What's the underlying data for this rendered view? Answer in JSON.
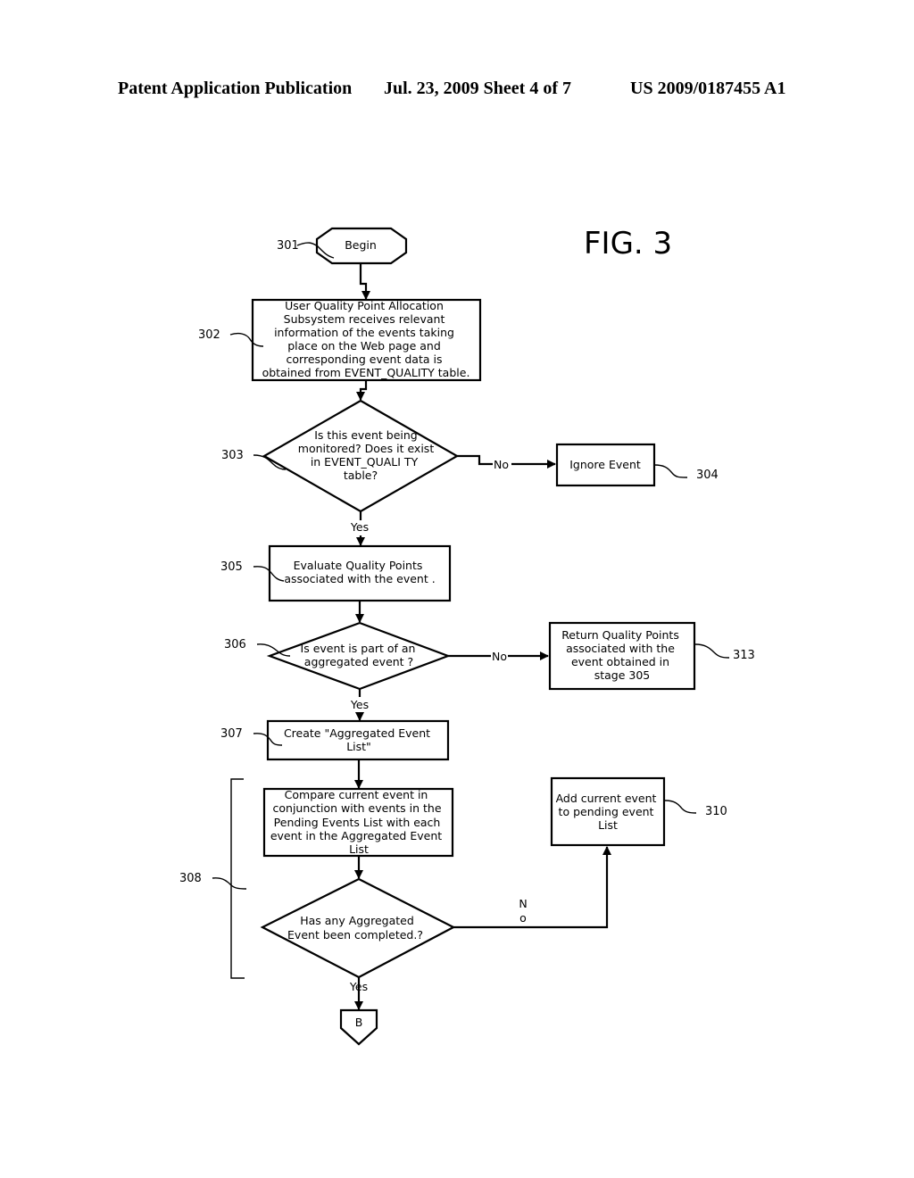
{
  "header": {
    "publication": "Patent Application Publication",
    "date_sheet": "Jul. 23, 2009   Sheet 4 of 7",
    "patent_number": "US 2009/0187455 A1"
  },
  "figure_label": "FIG. 3",
  "nodes": {
    "n301": {
      "ref": "301",
      "type": "terminator",
      "lines": [
        "Begin"
      ]
    },
    "n302": {
      "ref": "302",
      "type": "process",
      "lines": [
        "User Quality Point Allocation",
        "Subsystem receives relevant",
        "information of the events taking",
        "place on the Web page and",
        "corresponding event data is",
        "obtained from EVENT_QUALITY table."
      ]
    },
    "n303": {
      "ref": "303",
      "type": "decision",
      "lines": [
        "Is this event being",
        "monitored? Does it exist",
        "in EVENT_QUALI TY",
        "table?"
      ]
    },
    "n304": {
      "ref": "304",
      "type": "process",
      "lines": [
        "Ignore Event"
      ]
    },
    "n305": {
      "ref": "305",
      "type": "process",
      "lines": [
        "Evaluate Quality Points",
        "associated with the event ."
      ]
    },
    "n306": {
      "ref": "306",
      "type": "decision",
      "lines": [
        "Is event is part of an",
        "aggregated event ?"
      ]
    },
    "n313": {
      "ref": "313",
      "type": "process",
      "lines": [
        "Return Quality Points",
        "associated with the",
        "event obtained in",
        "stage 305"
      ]
    },
    "n307": {
      "ref": "307",
      "type": "process",
      "lines": [
        "Create \"Aggregated Event",
        "List\""
      ]
    },
    "n308a": {
      "type": "process",
      "lines": [
        "Compare current event  in",
        "conjunction with events in the",
        "Pending Events List with each",
        "event in the Aggregated Event",
        "List"
      ]
    },
    "n308b": {
      "type": "decision",
      "lines": [
        "Has any Aggregated",
        "Event been completed.?"
      ]
    },
    "n310": {
      "ref": "310",
      "type": "process",
      "lines": [
        "Add current event",
        "to pending event",
        "List"
      ]
    },
    "nB": {
      "type": "off-page-connector",
      "lines": [
        "B"
      ]
    }
  },
  "group_ref": "308",
  "edge_labels": {
    "e303_no": "No",
    "e303_yes": "Yes",
    "e306_no": "No",
    "e306_yes": "Yes",
    "e308_no_1": "N",
    "e308_no_2": "o",
    "e308_yes": "Yes"
  }
}
